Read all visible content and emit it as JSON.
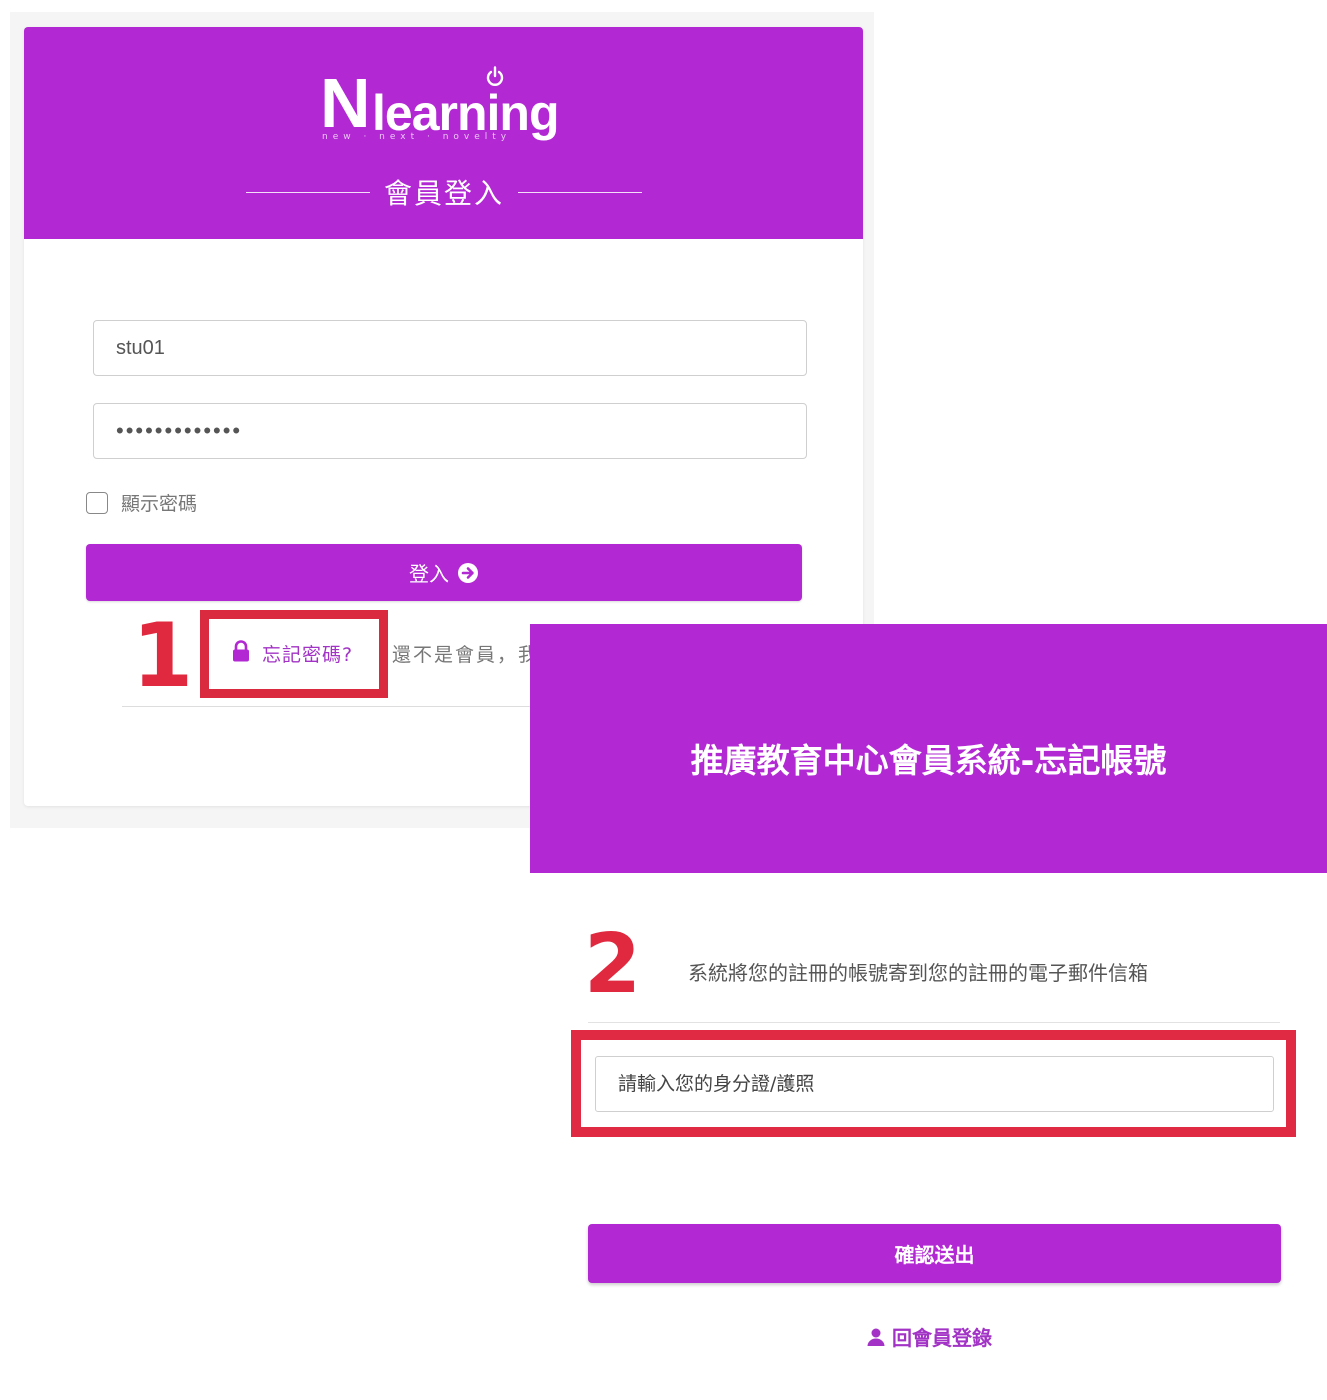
{
  "colors": {
    "brand_purple": "#b228d3",
    "link_purple": "#a233c6",
    "annotation_red": "#e0283e"
  },
  "login": {
    "logo_letter": "N",
    "logo_word": "learning",
    "logo_tagline": "new · next · novelty",
    "title": "會員登入",
    "username_value": "stu01",
    "password_value": "•••••••••••••",
    "show_password_label": "顯示密碼",
    "login_button_label": "登入",
    "login_button_icon": "arrow-circle-right-icon",
    "forgot_password_icon": "lock-icon",
    "forgot_password_label": "忘記密碼?",
    "not_member_text": "還不是會員，我"
  },
  "annotations": {
    "step1": "1",
    "step2": "2"
  },
  "forgot_account": {
    "title": "推廣教育中心會員系統-忘記帳號",
    "description": "系統將您的註冊的帳號寄到您的註冊的電子郵件信箱",
    "id_input_placeholder": "請輸入您的身分證/護照",
    "submit_label": "確認送出",
    "back_icon": "user-icon",
    "back_label": "回會員登錄"
  }
}
